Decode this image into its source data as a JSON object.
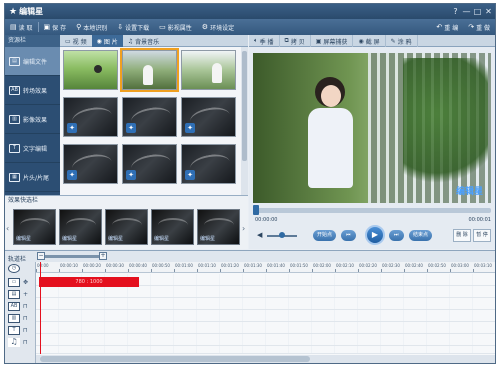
{
  "app": {
    "title": "编辑星",
    "window_controls": [
      "?",
      "—",
      "□",
      "✕"
    ]
  },
  "toolbar": {
    "items": [
      {
        "label": "读 取",
        "icon": "open-folder-icon"
      },
      {
        "label": "保 存",
        "icon": "save-icon"
      },
      {
        "label": "本地识别",
        "icon": "scan-icon"
      },
      {
        "label": "设置下载",
        "icon": "download-icon"
      },
      {
        "label": "影视属性",
        "icon": "film-icon"
      },
      {
        "label": "环境设定",
        "icon": "gear-icon"
      },
      {
        "label": "重 编",
        "icon": "undo-icon"
      },
      {
        "label": "重 做",
        "icon": "redo-icon"
      }
    ]
  },
  "sidebar": {
    "header": "资源栏",
    "items": [
      {
        "label": "编辑文件",
        "icon": "edit-file-icon",
        "active": true
      },
      {
        "label": "转场效果",
        "icon": "transition-icon",
        "active": false
      },
      {
        "label": "影像效果",
        "icon": "image-effect-icon",
        "active": false
      },
      {
        "label": "文字编辑",
        "icon": "text-edit-icon",
        "active": false
      },
      {
        "label": "片头/片尾",
        "icon": "clapper-icon",
        "active": false
      }
    ]
  },
  "library": {
    "tabs": [
      {
        "label": "视 频",
        "icon": "video-icon",
        "active": false
      },
      {
        "label": "图 片",
        "icon": "camera-icon",
        "active": true
      },
      {
        "label": "背景音乐",
        "icon": "music-icon",
        "active": false
      }
    ]
  },
  "effects": {
    "header": "效果快选栏",
    "items": [
      "编辑星",
      "编辑星",
      "编辑星",
      "编辑星",
      "编辑星"
    ]
  },
  "preview": {
    "toolbar": [
      {
        "label": "季 播",
        "icon": "audio-icon"
      },
      {
        "label": "拷 贝",
        "icon": "copy-icon"
      },
      {
        "label": "屏幕捕获",
        "icon": "capture-icon"
      },
      {
        "label": "截 屏",
        "icon": "screenshot-icon"
      },
      {
        "label": "涂 鸦",
        "icon": "brush-icon"
      }
    ],
    "watermark": "编辑星",
    "time_current": "00:00:00",
    "time_total": "00:00:01",
    "buttons": {
      "start_point": "开始点",
      "end_point": "结束点",
      "delete": "删 除",
      "stop": "暂 停"
    }
  },
  "timeline": {
    "label": "轨道栏",
    "ruler_ticks": [
      "00:00",
      "00:00:10",
      "00:00:20",
      "00:00:30",
      "00:00:40",
      "00:00:50",
      "00:01:00",
      "00:01:10",
      "00:01:20",
      "00:01:30",
      "00:01:40",
      "00:01:50",
      "00:02:00",
      "00:02:10",
      "00:02:20",
      "00:02:30",
      "00:02:40",
      "00:02:50",
      "00:03:00",
      "00:03:10"
    ],
    "clip_label": "780 : 1000",
    "track_icons": [
      {
        "a": "clock-icon",
        "b": ""
      },
      {
        "a": "film-strip-icon",
        "b": "move-icon"
      },
      {
        "a": "image-track-icon",
        "b": "plus-icon"
      },
      {
        "a": "effect-track-icon",
        "b": "lock-icon"
      },
      {
        "a": "text-track-icon",
        "b": "lock-icon"
      },
      {
        "a": "title-track-icon",
        "b": "lock-icon"
      },
      {
        "a": "music-note-icon",
        "b": "lock-icon"
      }
    ]
  }
}
